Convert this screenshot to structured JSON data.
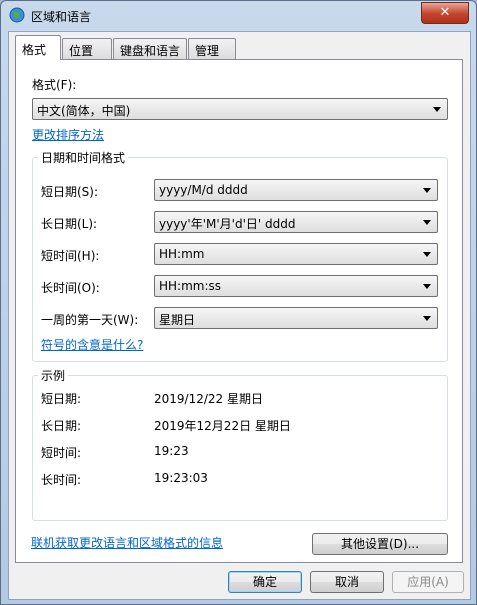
{
  "window": {
    "title": "区域和语言",
    "close_label": "✕"
  },
  "tabs": [
    "格式",
    "位置",
    "键盘和语言",
    "管理"
  ],
  "format": {
    "label": "格式(F):",
    "value": "中文(简体，中国)",
    "change_sort_link": "更改排序方法"
  },
  "datetime": {
    "group_title": "日期和时间格式",
    "rows": [
      {
        "label": "短日期(S):",
        "value": "yyyy/M/d dddd"
      },
      {
        "label": "长日期(L):",
        "value": "yyyy'年'M'月'd'日' dddd"
      },
      {
        "label": "短时间(H):",
        "value": "HH:mm"
      },
      {
        "label": "长时间(O):",
        "value": "HH:mm:ss"
      },
      {
        "label": "一周的第一天(W):",
        "value": "星期日"
      }
    ],
    "symbols_link": "符号的含意是什么?"
  },
  "examples": {
    "group_title": "示例",
    "rows": [
      {
        "label": "短日期:",
        "value": "2019/12/22 星期日"
      },
      {
        "label": "长日期:",
        "value": "2019年12月22日 星期日"
      },
      {
        "label": "短时间:",
        "value": "19:23"
      },
      {
        "label": "长时间:",
        "value": "19:23:03"
      }
    ]
  },
  "other_settings_button": "其他设置(D)...",
  "online_link": "联机获取更改语言和区域格式的信息",
  "footer": {
    "ok": "确定",
    "cancel": "取消",
    "apply": "应用(A)"
  }
}
